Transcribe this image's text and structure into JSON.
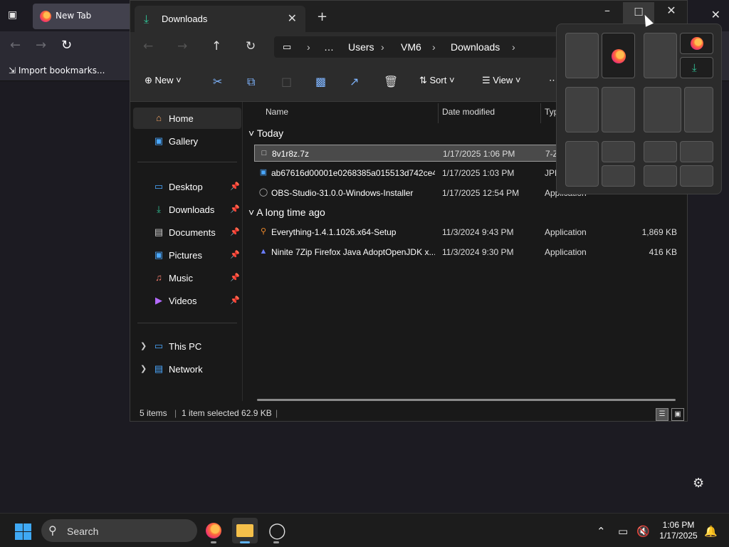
{
  "firefox": {
    "tab_title": "New Tab",
    "import_bookmarks": "Import bookmarks..."
  },
  "explorer": {
    "tab_title": "Downloads",
    "breadcrumbs": [
      "…",
      "Users",
      "VM6",
      "Downloads"
    ],
    "commands": {
      "new": "New",
      "sort": "Sort",
      "view": "View"
    },
    "nav": {
      "home": "Home",
      "gallery": "Gallery",
      "quick_access": [
        {
          "label": "Desktop",
          "icon": "desktop-icon",
          "pinned": true
        },
        {
          "label": "Downloads",
          "icon": "download-icon",
          "pinned": true
        },
        {
          "label": "Documents",
          "icon": "documents-icon",
          "pinned": true
        },
        {
          "label": "Pictures",
          "icon": "pictures-icon",
          "pinned": true
        },
        {
          "label": "Music",
          "icon": "music-icon",
          "pinned": true
        },
        {
          "label": "Videos",
          "icon": "videos-icon",
          "pinned": true
        }
      ],
      "this_pc": "This PC",
      "network": "Network"
    },
    "columns": {
      "name": "Name",
      "date": "Date modified",
      "type": "Typ"
    },
    "groups": [
      {
        "label": "Today",
        "files": [
          {
            "name": "8v1r8z.7z",
            "date": "1/17/2025 1:06 PM",
            "type": "7-Z",
            "size": "",
            "selected": true,
            "icon": "file-icon"
          },
          {
            "name": "ab67616d00001e0268385a015513d742ce4...",
            "date": "1/17/2025 1:03 PM",
            "type": "JPE",
            "size": "",
            "selected": false,
            "icon": "image-file-icon"
          },
          {
            "name": "OBS-Studio-31.0.0-Windows-Installer",
            "date": "1/17/2025 12:54 PM",
            "type": "Application",
            "size": "",
            "selected": false,
            "icon": "obs-icon"
          }
        ]
      },
      {
        "label": "A long time ago",
        "files": [
          {
            "name": "Everything-1.4.1.1026.x64-Setup",
            "date": "11/3/2024 9:43 PM",
            "type": "Application",
            "size": "1,869 KB",
            "selected": false,
            "icon": "everything-icon"
          },
          {
            "name": "Ninite 7Zip Firefox Java AdoptOpenJDK x...",
            "date": "11/3/2024 9:30 PM",
            "type": "Application",
            "size": "416 KB",
            "selected": false,
            "icon": "ninite-icon"
          }
        ]
      }
    ],
    "status": {
      "items": "5 items",
      "selected": "1 item selected  62.9 KB"
    }
  },
  "taskbar": {
    "search_label": "Search",
    "time": "1:06 PM",
    "date": "1/17/2025"
  },
  "colors": {
    "accent": "#3fa9f5",
    "download_green": "#30c296"
  }
}
